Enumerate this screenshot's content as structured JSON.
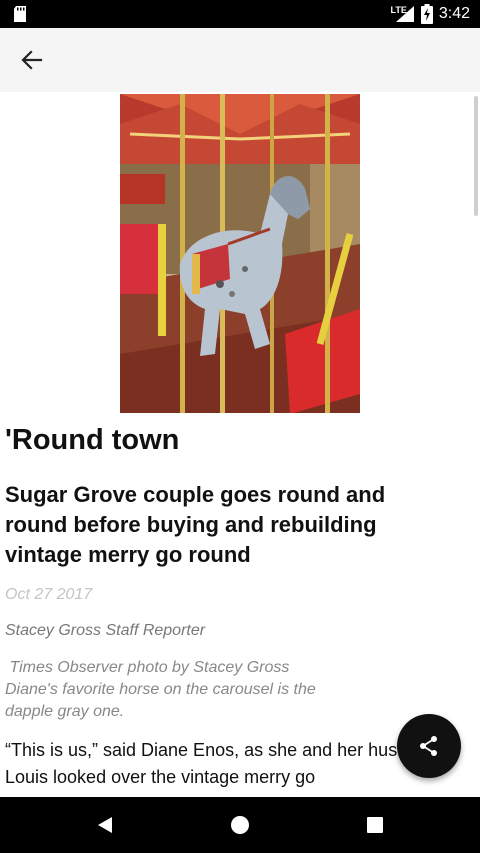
{
  "status_bar": {
    "network": "LTE",
    "time": "3:42",
    "icons": [
      "sd-card-icon",
      "signal-icon",
      "battery-charging-icon"
    ]
  },
  "toolbar": {
    "back_icon": "arrow-back-icon"
  },
  "article": {
    "section_title": "'Round town",
    "headline": "Sugar Grove couple goes round and round before buying and rebuilding vintage merry go round",
    "date": "Oct 27 2017",
    "byline": "Stacey Gross Staff Reporter",
    "photo_caption_line1": " Times Observer photo by Stacey Gross",
    "photo_caption_line2": "Diane's favorite horse on the carousel is the dapple gray one.",
    "body_text": "“This is us,” said Diane Enos, as she and her husband Louis looked over the vintage merry go"
  },
  "fab": {
    "icon": "share-icon"
  },
  "nav_bar": {
    "icons": [
      "nav-back-icon",
      "nav-home-icon",
      "nav-recents-icon"
    ]
  }
}
